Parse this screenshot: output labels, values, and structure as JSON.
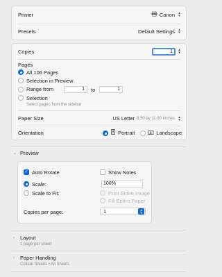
{
  "printer": {
    "label": "Printer",
    "value": "Canon",
    "icon": "printer-icon"
  },
  "presets": {
    "label": "Presets",
    "value": "Default Settings"
  },
  "copies": {
    "label": "Copies",
    "value": "1"
  },
  "pages": {
    "label": "Pages",
    "options": [
      {
        "label": "All 106 Pages",
        "selected": true
      },
      {
        "label": "Selection in Preview",
        "selected": false
      },
      {
        "label": "Range from",
        "selected": false
      },
      {
        "label": "Selection",
        "selected": false
      }
    ],
    "range_from": "1",
    "range_to_label": "to",
    "range_to": "1",
    "selection_hint": "Select pages from the sidebar"
  },
  "paper_size": {
    "label": "Paper Size",
    "value": "US Letter",
    "detail": "8.50 by 11.00 inches"
  },
  "orientation": {
    "label": "Orientation",
    "portrait": "Portrait",
    "landscape": "Landscape",
    "selected": "Portrait"
  },
  "preview": {
    "title": "Preview",
    "auto_rotate": "Auto Rotate",
    "show_notes": "Show Notes",
    "scale_label": "Scale:",
    "scale_value": "100%",
    "scale_to_fit": "Scale to Fit:",
    "print_entire_image": "Print Entire Image",
    "fill_entire_paper": "Fill Entire Paper",
    "copies_per_page_label": "Copies per page:",
    "copies_per_page_value": "1",
    "accent": "#0a68d8"
  },
  "layout": {
    "title": "Layout",
    "summary": "1 page per sheet"
  },
  "paper_handling": {
    "title": "Paper Handling",
    "summary": "Collate Sheets • All Sheets"
  }
}
